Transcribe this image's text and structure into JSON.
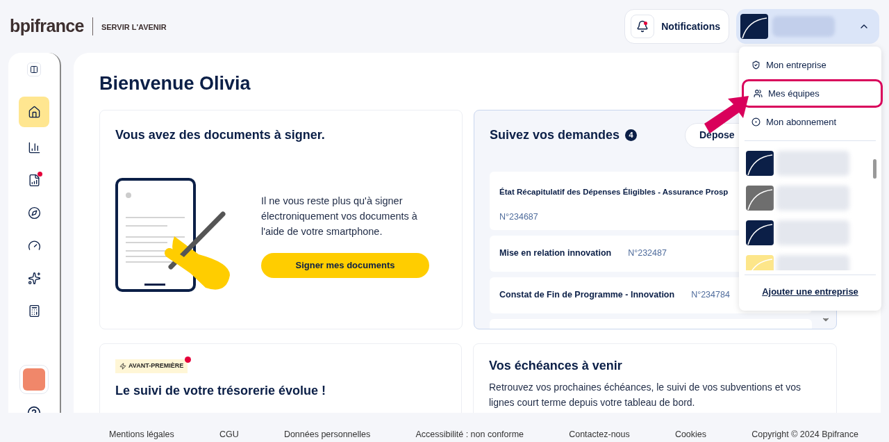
{
  "header": {
    "logo": "bpifrance",
    "tagline": "SERVIR L'AVENIR",
    "notifications": "Notifications",
    "profile_menu_expanded": true
  },
  "sidebar": {
    "items": [
      {
        "selected": true,
        "badge": false
      },
      {
        "selected": false,
        "badge": false
      },
      {
        "selected": false,
        "badge": true
      },
      {
        "selected": false,
        "badge": false
      },
      {
        "selected": false,
        "badge": false
      },
      {
        "selected": false,
        "badge": false
      },
      {
        "selected": false,
        "badge": false
      }
    ]
  },
  "main": {
    "title": "Bienvenue Olivia",
    "sign_card": {
      "title": "Vous avez des documents à signer.",
      "text": "Il ne vous reste plus qu'à signer électroniquement vos documents à l'aide de votre smartphone.",
      "button": "Signer mes documents"
    },
    "requests": {
      "title": "Suivez vos demandes",
      "count": "4",
      "button": "Dépose",
      "items": [
        {
          "title": "État Récapitulatif des Dépenses Éligibles - Assurance Prosp",
          "number": "N°234687",
          "kind": "stacked"
        },
        {
          "title": "Mise en relation innovation",
          "number": "N°232487",
          "kind": "inline"
        },
        {
          "title": "Constat de Fin de Programme - Innovation",
          "number": "N°234784",
          "kind": "inline"
        }
      ]
    },
    "treasury_card": {
      "badge": "AVANT-PREMIÈRE",
      "title": "Le suivi de votre trésorerie évolue !"
    },
    "deadlines_card": {
      "title": "Vos échéances à venir",
      "text": "Retrouvez vos prochaines échéances, le suivi de vos subventions et vos lignes court terme depuis votre tableau de bord."
    }
  },
  "dropdown": {
    "items": [
      {
        "label": "Mon entreprise",
        "highlighted": false
      },
      {
        "label": "Mes équipes",
        "highlighted": true
      },
      {
        "label": "Mon abonnement",
        "highlighted": false
      }
    ],
    "companies": [
      {
        "color": "#0b1f47"
      },
      {
        "color": "#6e6e6e"
      },
      {
        "color": "#0b1f47"
      },
      {
        "color": "#fde68a"
      }
    ],
    "add_link": "Ajouter une entreprise"
  },
  "footer": {
    "links": [
      "Mentions légales",
      "CGU",
      "Données personnelles",
      "Accessibilité : non conforme",
      "Contactez-nous",
      "Cookies",
      "Copyright © 2024 Bpifrance"
    ]
  }
}
